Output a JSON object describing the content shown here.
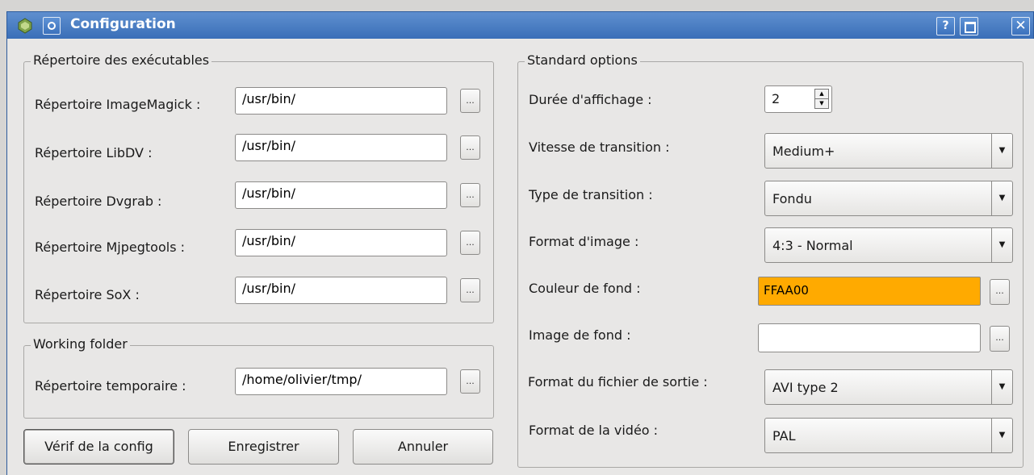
{
  "window": {
    "title": "Configuration",
    "help_label": "?",
    "close_label": "✕"
  },
  "executables": {
    "legend": "Répertoire des exécutables",
    "browse_label": "...",
    "rows": [
      {
        "label": "Répertoire ImageMagick :",
        "value": "/usr/bin/"
      },
      {
        "label": "Répertoire LibDV :",
        "value": "/usr/bin/"
      },
      {
        "label": "Répertoire Dvgrab :",
        "value": "/usr/bin/"
      },
      {
        "label": "Répertoire Mjpegtools :",
        "value": "/usr/bin/"
      },
      {
        "label": "Répertoire SoX :",
        "value": "/usr/bin/"
      }
    ]
  },
  "working": {
    "legend": "Working folder",
    "temp_label": "Répertoire temporaire :",
    "temp_value": "/home/olivier/tmp/"
  },
  "buttons": {
    "check": "Vérif de la config",
    "save": "Enregistrer",
    "cancel": "Annuler"
  },
  "standard": {
    "legend": "Standard options",
    "duration_label": "Durée d'affichage :",
    "duration_value": "2",
    "speed_label": "Vitesse de transition :",
    "speed_value": "Medium+",
    "transition_label": "Type de transition :",
    "transition_value": "Fondu",
    "image_format_label": "Format d'image :",
    "image_format_value": "4:3 - Normal",
    "bg_color_label": "Couleur de fond :",
    "bg_color_value": "FFAA00",
    "bg_color_hex": "#FFAA00",
    "bg_image_label": "Image de fond :",
    "bg_image_value": "",
    "output_format_label": "Format du fichier de sortie :",
    "output_format_value": "AVI type 2",
    "video_format_label": "Format de la vidéo :",
    "video_format_value": "PAL"
  },
  "colors": {
    "titlebar": "#3a6fb8",
    "window_bg": "#e8e7e6"
  }
}
